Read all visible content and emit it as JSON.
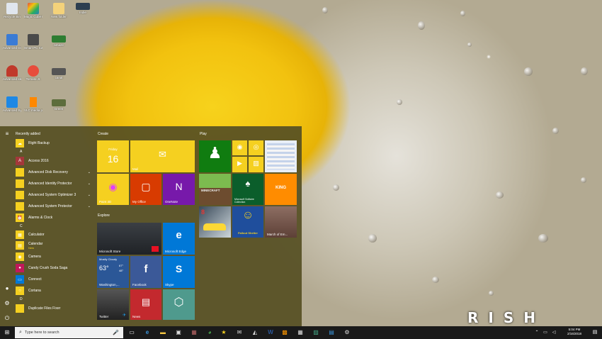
{
  "desktop": {
    "icons": [
      {
        "label": "Recycle Bin",
        "color": "#e0e6ee",
        "icon": "recycle-bin-icon"
      },
      {
        "label": "Magic Cube Pro",
        "color": "#c0392b",
        "icon": "cube-icon"
      },
      {
        "label": "New folder",
        "color": "#f4d27a",
        "icon": "folder-icon"
      },
      {
        "label": "Indie",
        "color": "#2c3e50",
        "icon": "image-icon"
      },
      {
        "label": "Advanced Disk Reco...",
        "color": "#3a7bd5",
        "icon": "disk-icon"
      },
      {
        "label": "Smart PC Care",
        "color": "#4a4a4a",
        "icon": "pc-icon"
      },
      {
        "label": "amaze",
        "color": "#2e7d32",
        "icon": "image-icon"
      },
      {
        "label": "Advanced Identity P...",
        "color": "#c0392b",
        "icon": "shield-icon"
      },
      {
        "label": "Tomato Jr.",
        "color": "#e74c3c",
        "icon": "tomato-icon"
      },
      {
        "label": "canal",
        "color": "#555",
        "icon": "image-icon"
      },
      {
        "label": "Advanced System o...",
        "color": "#1e88e5",
        "icon": "system-icon"
      },
      {
        "label": "VLC media player",
        "color": "#ff8800",
        "icon": "vlc-icon"
      },
      {
        "label": "Green",
        "color": "#5d6d3c",
        "icon": "image-icon"
      }
    ],
    "watermark": "RISH"
  },
  "start": {
    "rail": [
      "hamburger-icon",
      "user-icon",
      "settings-icon",
      "power-icon"
    ],
    "recently_added_header": "Recently added",
    "recent": [
      {
        "label": "Right Backup",
        "color": "#f5d020",
        "icon": "cloud-icon"
      }
    ],
    "sections": [
      {
        "letter": "A",
        "apps": [
          {
            "label": "Access 2016",
            "color": "#a4373a",
            "glyph": "A",
            "chevron": false
          },
          {
            "label": "Advanced Disk Recovery",
            "color": "#f5d020",
            "glyph": "",
            "chevron": true
          },
          {
            "label": "Advanced Identity Protector",
            "color": "#f5d020",
            "glyph": "",
            "chevron": true
          },
          {
            "label": "Advanced System Optimizer 3",
            "color": "#f5d020",
            "glyph": "",
            "chevron": true
          },
          {
            "label": "Advanced System Protector",
            "color": "#f5d020",
            "glyph": "",
            "chevron": true
          },
          {
            "label": "Alarms & Clock",
            "color": "#f5d020",
            "glyph": "⏰",
            "chevron": false
          }
        ]
      },
      {
        "letter": "C",
        "apps": [
          {
            "label": "Calculator",
            "color": "#f5d020",
            "glyph": "▦",
            "chevron": false
          },
          {
            "label": "Calendar",
            "color": "#f5d020",
            "glyph": "▤",
            "chevron": false,
            "badge": "New"
          },
          {
            "label": "Camera",
            "color": "#f5d020",
            "glyph": "◉",
            "chevron": false
          },
          {
            "label": "Candy Crush Soda Saga",
            "color": "#c2185b",
            "glyph": "●",
            "chevron": false
          },
          {
            "label": "Connect",
            "color": "#0078d7",
            "glyph": "▭",
            "chevron": false
          },
          {
            "label": "Cortana",
            "color": "#f5d020",
            "glyph": "○",
            "chevron": false
          }
        ]
      },
      {
        "letter": "D",
        "apps": [
          {
            "label": "Duplicate Files Fixer",
            "color": "#f5d020",
            "glyph": "",
            "chevron": false
          }
        ]
      }
    ],
    "groups": {
      "create": "Create",
      "explore": "Explore",
      "play": "Play"
    },
    "tiles": {
      "calendar": {
        "day": "Friday",
        "date": "16"
      },
      "mail": {
        "label": "Mail"
      },
      "paint3d": {
        "label": "Paint 3D"
      },
      "myoffice": {
        "label": "My Office"
      },
      "onenote": {
        "label": "OneNote"
      },
      "store": {
        "label": "Microsoft Store"
      },
      "edge": {
        "label": "Microsoft Edge"
      },
      "weather": {
        "condition": "Mostly Cloudy",
        "temp": "63°",
        "high": "67°",
        "low": "48°",
        "city": "Washington,..."
      },
      "facebook": {
        "label": "Facebook"
      },
      "skype": {
        "label": "Skype"
      },
      "twitter": {
        "label": "Twitter"
      },
      "news": {
        "label": "News"
      },
      "unknown": {
        "label": ""
      },
      "xbox": {
        "label": "Xbox"
      },
      "minecraft": {
        "label": "MINECRAFT"
      },
      "solitaire": {
        "label": "Microsoft Solitaire Collection"
      },
      "king": {
        "label": "KING"
      },
      "asphalt": {
        "label": "8"
      },
      "fallout": {
        "label": "Fallout Shelter"
      },
      "march": {
        "label": "March of Em..."
      }
    }
  },
  "taskbar": {
    "search_placeholder": "Type here to search",
    "time": "5:04 PM",
    "date": "2/16/2018"
  }
}
